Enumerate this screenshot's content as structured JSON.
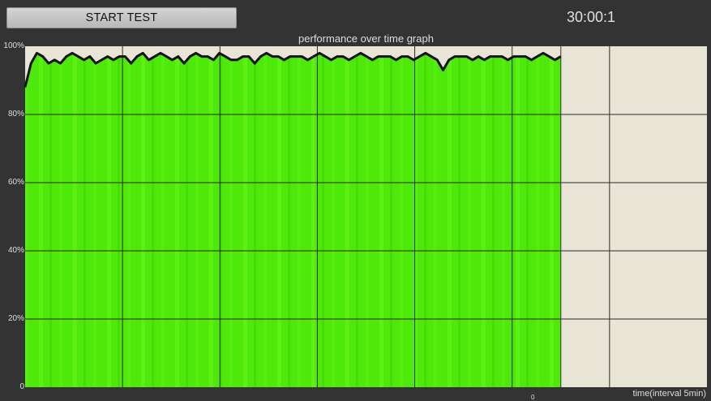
{
  "toolbar": {
    "start_label": "START TEST"
  },
  "timer": "30:00:1",
  "graph": {
    "title": "performance over time graph",
    "x_label": "time(interval 5min)",
    "x_tick": "0",
    "y_ticks": [
      "100%",
      "80%",
      "60%",
      "40%",
      "20%",
      "0"
    ]
  },
  "colors": {
    "background": "#333333",
    "plot_area": "#e8e5d6",
    "fill": "#4ee80a",
    "line": "#111111",
    "grid": "#2a2a2a"
  },
  "chart_data": {
    "type": "area",
    "title": "performance over time graph",
    "xlabel": "time(interval 5min)",
    "ylabel": "",
    "xlim": [
      0,
      35
    ],
    "ylim": [
      0,
      100
    ],
    "ytick_labels": [
      "100%",
      "80%",
      "60%",
      "40%",
      "20%",
      "0"
    ],
    "grid": true,
    "series": [
      {
        "values": [
          88,
          95,
          98,
          97,
          95,
          96,
          95,
          97,
          98,
          97,
          96,
          97,
          95,
          96,
          97,
          96,
          97,
          97,
          95,
          97,
          98,
          96,
          97,
          98,
          97,
          96,
          97,
          95,
          97,
          98,
          97,
          97,
          96,
          98,
          97,
          96,
          96,
          97,
          97,
          95,
          97,
          98,
          97,
          97,
          96,
          97,
          97,
          97,
          96,
          97,
          98,
          97,
          96,
          97,
          97,
          96,
          97,
          98,
          97,
          96,
          97,
          97,
          97,
          96,
          97,
          97,
          96,
          97,
          98,
          97,
          96,
          93,
          96,
          97,
          97,
          97,
          96,
          97,
          96,
          97,
          97,
          97,
          96,
          97,
          97,
          97,
          96,
          97,
          98,
          97,
          96,
          97
        ]
      }
    ]
  }
}
